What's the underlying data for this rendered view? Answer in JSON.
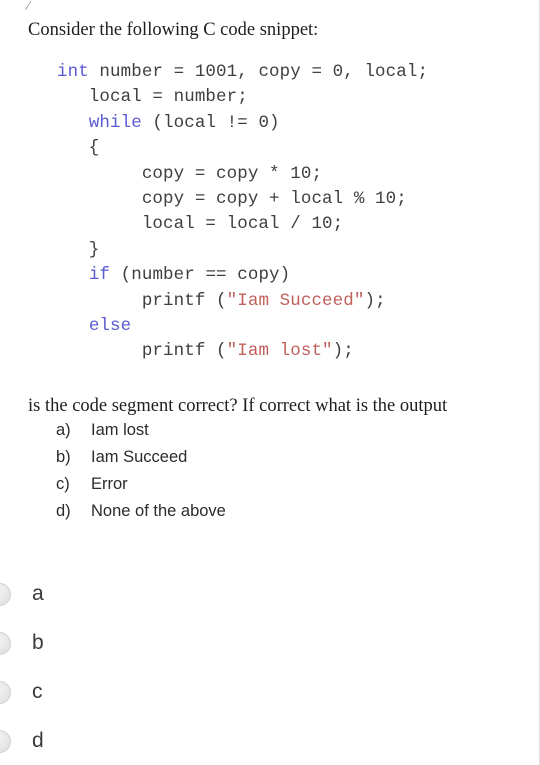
{
  "prompt": "Consider the following C code snippet:",
  "code": {
    "language": "C",
    "lines": [
      [
        {
          "t": "int",
          "c": "keyword"
        },
        {
          "t": " number = 1001, copy = 0, local;",
          "c": "plain"
        }
      ],
      [
        {
          "t": "   local = number;",
          "c": "plain"
        }
      ],
      [
        {
          "t": "   ",
          "c": "plain"
        },
        {
          "t": "while",
          "c": "keyword"
        },
        {
          "t": " (local != 0)",
          "c": "plain"
        }
      ],
      [
        {
          "t": "   {",
          "c": "plain"
        }
      ],
      [
        {
          "t": "        copy = copy * 10;",
          "c": "plain"
        }
      ],
      [
        {
          "t": "        copy = copy + local % 10;",
          "c": "plain"
        }
      ],
      [
        {
          "t": "        local = local / 10;",
          "c": "plain"
        }
      ],
      [
        {
          "t": "   }",
          "c": "plain"
        }
      ],
      [
        {
          "t": "   ",
          "c": "plain"
        },
        {
          "t": "if",
          "c": "keyword"
        },
        {
          "t": " (number == copy)",
          "c": "plain"
        }
      ],
      [
        {
          "t": "        printf (",
          "c": "plain"
        },
        {
          "t": "\"Iam Succeed\"",
          "c": "string"
        },
        {
          "t": ");",
          "c": "plain"
        }
      ],
      [
        {
          "t": "   ",
          "c": "plain"
        },
        {
          "t": "else",
          "c": "keyword"
        }
      ],
      [
        {
          "t": "        printf (",
          "c": "plain"
        },
        {
          "t": "\"Iam lost\"",
          "c": "string"
        },
        {
          "t": ");",
          "c": "plain"
        }
      ]
    ],
    "colors": {
      "keyword": "#5a5ad2",
      "string": "#c0605c",
      "plain": "#3f3f3f"
    }
  },
  "question": "is the code segment correct?  If correct what is the output",
  "choices": [
    {
      "marker": "a)",
      "text": "Iam lost"
    },
    {
      "marker": "b)",
      "text": "Iam Succeed"
    },
    {
      "marker": "c)",
      "text": "Error"
    },
    {
      "marker": "d)",
      "text": "None of the above"
    }
  ],
  "answer_radios": [
    {
      "label": "a",
      "selected": false
    },
    {
      "label": "b",
      "selected": false
    },
    {
      "label": "c",
      "selected": false
    },
    {
      "label": "d",
      "selected": false
    }
  ],
  "artifact": {
    "glyph": "/"
  }
}
